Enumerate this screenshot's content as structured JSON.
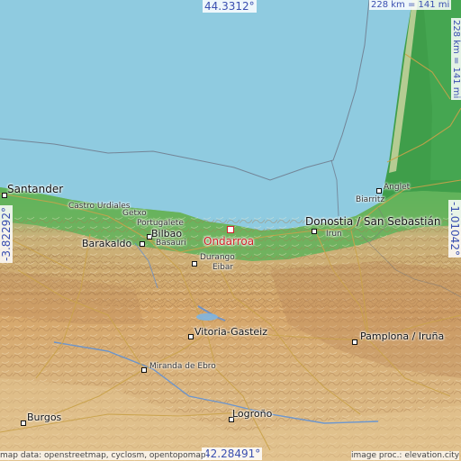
{
  "coordinates": {
    "top": "44.3312°",
    "bottom": "42.28491°",
    "left": "-3.82292°",
    "right": "-1.01042°"
  },
  "scale": {
    "horizontal": "228 km = 141 mi",
    "vertical": "228 km = 141 mi"
  },
  "main_place": {
    "name": "Ondarroa"
  },
  "places": {
    "santander": "Santander",
    "castro_urdiales": "Castro Urdiales",
    "getxo": "Getxo",
    "portugalete": "Portugalete",
    "bilbao": "Bilbao",
    "barakaldo": "Barakaldo",
    "basauri": "Basauri",
    "durango": "Durango",
    "eibar": "Eibar",
    "donostia": "Donostia / San Sebastián",
    "irun": "Irun",
    "anglet": "Anglet",
    "biarritz": "Biarritz",
    "vitoria": "Vitoria-Gasteiz",
    "pamplona": "Pamplona / Iruña",
    "miranda": "Miranda de Ebro",
    "logrono": "Logroño",
    "burgos": "Burgos"
  },
  "attribution": {
    "left": "map data: openstreetmap, cyclosm, opentopomap",
    "right": "image proc.: elevation.city"
  },
  "colors": {
    "sea": "#8fcbe0",
    "lowland_green": "#4caa55",
    "hills_tan": "#d9b47e",
    "mountains_brown": "#b98858",
    "main_marker": "#d0202a",
    "coordinate_text": "#3a4fb0"
  }
}
